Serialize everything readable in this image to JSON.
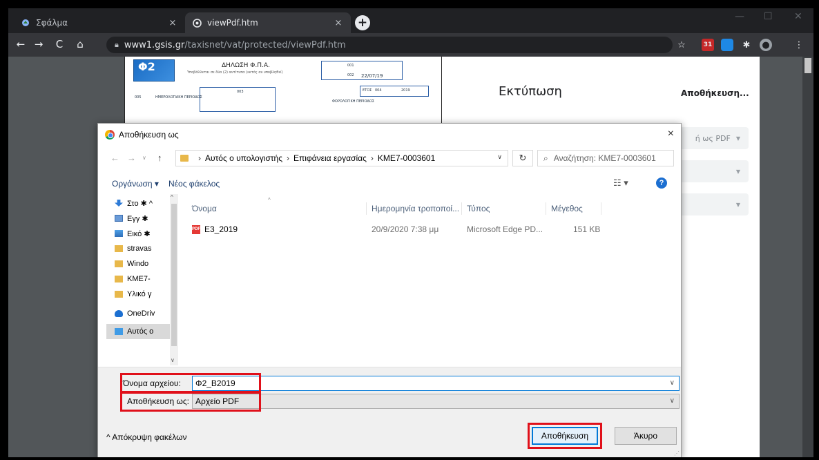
{
  "browser": {
    "tabs": [
      {
        "title": "Σφάλμα",
        "close": "×"
      },
      {
        "title": "viewPdf.htm",
        "close": "×"
      }
    ],
    "new_tab": "+",
    "url_host": "www1.gsis.gr",
    "url_path": "/taxisnet/vat/protected/viewPdf.htm",
    "extension_badge": "31"
  },
  "pdf": {
    "logo": "Φ2",
    "title": "ΔΗΛΩΣΗ Φ.Π.Α.",
    "subtitle": "Υποβάλλεται σε δύο (2) αντίτυπα (εκτός αν υποβληθεί)",
    "tag_001": "001",
    "tag_002": "002",
    "tag_003": "003",
    "tag_004": "004",
    "tag_005": "005",
    "date": "22/07/19",
    "year_label": "ΕΤΟΣ",
    "year": "2019",
    "period_label": "ΗΜΕΡΟΛΟΓΙΑΚΗ ΠΕΡΙΟΔΟΣ",
    "fiscal_period_label": "ΦΟΡΟΛΟΓΙΚΗ ΠΕΡΙΟΔΟΣ"
  },
  "print_panel": {
    "title": "Εκτύπωση",
    "save_button": "Αποθήκευση...",
    "destination": "ή ως PDF"
  },
  "dialog": {
    "title": "Αποθήκευση ως",
    "close": "×",
    "breadcrumb": [
      "Αυτός ο υπολογιστής",
      "Επιφάνεια εργασίας",
      "KME7-0003601"
    ],
    "search_placeholder": "Αναζήτηση: KME7-0003601",
    "organize": "Οργάνωση ▾",
    "new_folder": "Νέος φάκελος",
    "nav_items": [
      {
        "label": "Στο ✱ ^",
        "icon": "download-icon"
      },
      {
        "label": "Εγγ ✱",
        "icon": "documents-icon"
      },
      {
        "label": "Εικό ✱",
        "icon": "pictures-icon"
      },
      {
        "label": "stravas",
        "icon": "folder-icon"
      },
      {
        "label": "Windo",
        "icon": "folder-icon"
      },
      {
        "label": "KME7-",
        "icon": "folder-icon"
      },
      {
        "label": "Υλικό γ",
        "icon": "folder-icon"
      },
      {
        "label": "OneDriv",
        "icon": "onedrive-icon"
      },
      {
        "label": "Αυτός ο",
        "icon": "this-pc-icon"
      }
    ],
    "columns": {
      "name": "Όνομα",
      "modified": "Ημερομηνία τροποποί...",
      "type": "Τύπος",
      "size": "Μέγεθος"
    },
    "files": [
      {
        "name": "E3_2019",
        "modified": "20/9/2020 7:38 μμ",
        "type": "Microsoft Edge PD...",
        "size": "151 KB"
      }
    ],
    "filename_label": "Όνομα αρχείου:",
    "filename_value": "Φ2_Β2019",
    "savetype_label": "Αποθήκευση ως:",
    "savetype_value": "Αρχείο PDF",
    "hide_folders": "^ Απόκρυψη φακέλων",
    "save_button": "Αποθήκευση",
    "cancel_button": "Άκυρο"
  },
  "colors": {
    "highlight_red": "#e0101a",
    "primary_blue": "#0078d7",
    "chrome_dark": "#202124"
  }
}
